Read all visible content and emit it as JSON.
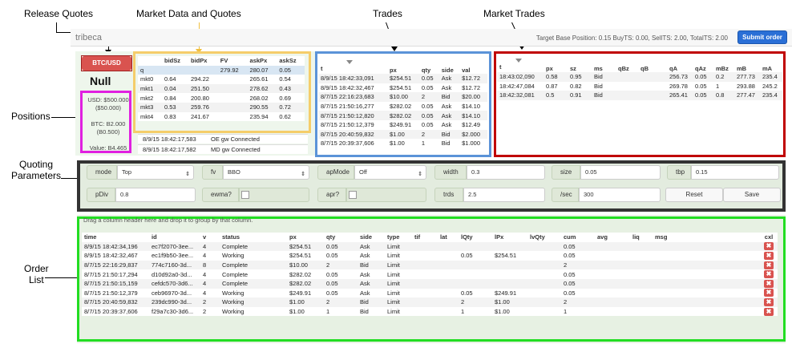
{
  "annotations": {
    "release_quotes": "Release Quotes",
    "market_data": "Market Data and Quotes",
    "trades": "Trades",
    "market_trades": "Market Trades",
    "positions": "Positions",
    "quoting_parameters_1": "Quoting",
    "quoting_parameters_2": "Parameters",
    "order_list_1": "Order",
    "order_list_2": "List"
  },
  "topbar": {
    "brand": "tribeca",
    "stats": "Target Base Position: 0.15     BuyTS: 0.00, SellTS: 2.00, TotalTS: 2.00",
    "submit_label": "Submit order"
  },
  "positions": {
    "symbol_button": "BTC/USD",
    "status": "Null",
    "usd": "USD: $500.000",
    "usd_held": "($50.000)",
    "btc": "BTC: B2.000",
    "btc_held": "(B0.500)",
    "value": "Value: B4.465"
  },
  "market_data": {
    "headers": [
      "",
      "bidSz",
      "bidPx",
      "FV",
      "askPx",
      "askSz"
    ],
    "rows": [
      [
        "q",
        "",
        "",
        "279.92",
        "280.07",
        "0.05"
      ],
      [
        "mkt0",
        "0.64",
        "294.22",
        "",
        "265.61",
        "0.54"
      ],
      [
        "mkt1",
        "0.04",
        "251.50",
        "",
        "278.62",
        "0.43"
      ],
      [
        "mkt2",
        "0.84",
        "200.80",
        "",
        "268.02",
        "0.69"
      ],
      [
        "mkt3",
        "0.53",
        "259.76",
        "",
        "290.55",
        "0.72"
      ],
      [
        "mkt4",
        "0.83",
        "241.67",
        "",
        "235.94",
        "0.62"
      ]
    ],
    "connections": [
      {
        "time": "8/9/15 18:42:17,583",
        "text": "OE gw Connected"
      },
      {
        "time": "8/9/15 18:42:17,582",
        "text": "MD gw Connected"
      }
    ]
  },
  "trades": {
    "headers": [
      "t",
      "px",
      "qty",
      "side",
      "val"
    ],
    "rows": [
      [
        "8/9/15 18:42:33,091",
        "$254.51",
        "0.05",
        "Ask",
        "$12.72"
      ],
      [
        "8/9/15 18:42:32,467",
        "$254.51",
        "0.05",
        "Ask",
        "$12.72"
      ],
      [
        "8/7/15 22:16:23,683",
        "$10.00",
        "2",
        "Bid",
        "$20.00"
      ],
      [
        "8/7/15 21:50:16,277",
        "$282.02",
        "0.05",
        "Ask",
        "$14.10"
      ],
      [
        "8/7/15 21:50:12,820",
        "$282.02",
        "0.05",
        "Ask",
        "$14.10"
      ],
      [
        "8/7/15 21:50:12,379",
        "$249.91",
        "0.05",
        "Ask",
        "$12.49"
      ],
      [
        "8/7/15 20:40:59,832",
        "$1.00",
        "2",
        "Bid",
        "$2.000"
      ],
      [
        "8/7/15 20:39:37,606",
        "$1.00",
        "1",
        "Bid",
        "$1.000"
      ]
    ]
  },
  "market_trades": {
    "headers": [
      "t",
      "px",
      "sz",
      "ms",
      "qBz",
      "qB",
      "qA",
      "qAz",
      "mBz",
      "mB",
      "mA"
    ],
    "rows": [
      [
        "18:43:02,090",
        "0.58",
        "0.95",
        "Bid",
        "",
        "",
        "256.73",
        "0.05",
        "0.2",
        "277.73",
        "235.4"
      ],
      [
        "18:42:47,084",
        "0.87",
        "0.82",
        "Bid",
        "",
        "",
        "269.78",
        "0.05",
        "1",
        "293.88",
        "245.2"
      ],
      [
        "18:42:32,081",
        "0.5",
        "0.91",
        "Bid",
        "",
        "",
        "265.41",
        "0.05",
        "0.8",
        "277.47",
        "235.4"
      ]
    ]
  },
  "quoting": {
    "mode_label": "mode",
    "mode_value": "Top",
    "fv_label": "fv",
    "fv_value": "BBO",
    "apmode_label": "apMode",
    "apmode_value": "Off",
    "width_label": "width",
    "width_value": "0.3",
    "size_label": "size",
    "size_value": "0.05",
    "tbp_label": "tbp",
    "tbp_value": "0.15",
    "pdiv_label": "pDiv",
    "pdiv_value": "0.8",
    "ewma_label": "ewma?",
    "apr_label": "apr?",
    "trds_label": "trds",
    "trds_value": "2.5",
    "sec_label": "/sec",
    "sec_value": "300",
    "reset_label": "Reset",
    "save_label": "Save"
  },
  "orders": {
    "hint": "Drag a column header here and drop it to group by that column.",
    "headers": [
      "time",
      "id",
      "v",
      "status",
      "px",
      "qty",
      "side",
      "type",
      "tif",
      "lat",
      "lQty",
      "lPx",
      "lvQty",
      "cum",
      "avg",
      "liq",
      "msg",
      "cxl"
    ],
    "rows": [
      [
        "8/9/15 18:42:34,196",
        "ec7f2070-3ee...",
        "4",
        "Complete",
        "$254.51",
        "0.05",
        "Ask",
        "Limit",
        "",
        "",
        "",
        "",
        "",
        "0.05",
        "",
        "",
        ""
      ],
      [
        "8/9/15 18:42:32,467",
        "ec1f9b50-3ee...",
        "4",
        "Working",
        "$254.51",
        "0.05",
        "Ask",
        "Limit",
        "",
        "",
        "0.05",
        "$254.51",
        "",
        "0.05",
        "",
        "",
        ""
      ],
      [
        "8/7/15 22:16:29,837",
        "774c7160-3d...",
        "8",
        "Complete",
        "$10.00",
        "2",
        "Bid",
        "Limit",
        "",
        "",
        "",
        "",
        "",
        "2",
        "",
        "",
        ""
      ],
      [
        "8/7/15 21:50:17,294",
        "d10d92a0-3d...",
        "4",
        "Complete",
        "$282.02",
        "0.05",
        "Ask",
        "Limit",
        "",
        "",
        "",
        "",
        "",
        "0.05",
        "",
        "",
        ""
      ],
      [
        "8/7/15 21:50:15,159",
        "cefdc570-3d6...",
        "4",
        "Complete",
        "$282.02",
        "0.05",
        "Ask",
        "Limit",
        "",
        "",
        "",
        "",
        "",
        "0.05",
        "",
        "",
        ""
      ],
      [
        "8/7/15 21:50:12,379",
        "ceb96970-3d...",
        "4",
        "Working",
        "$249.91",
        "0.05",
        "Ask",
        "Limit",
        "",
        "",
        "0.05",
        "$249.91",
        "",
        "0.05",
        "",
        "",
        ""
      ],
      [
        "8/7/15 20:40:59,832",
        "239dc990-3d...",
        "2",
        "Working",
        "$1.00",
        "2",
        "Bid",
        "Limit",
        "",
        "",
        "2",
        "$1.00",
        "",
        "2",
        "",
        "",
        ""
      ],
      [
        "8/7/15 20:39:37,606",
        "f29a7c30-3d6...",
        "2",
        "Working",
        "$1.00",
        "1",
        "Bid",
        "Limit",
        "",
        "",
        "1",
        "$1.00",
        "",
        "1",
        "",
        "",
        ""
      ]
    ],
    "cxl_glyph": "✖"
  },
  "colors": {
    "release": "#d9534f",
    "positions": "#e020e0",
    "market_data": "#f5cd6a",
    "trades": "#5b93d8",
    "market_trades": "#c00000",
    "quoting": "#333333",
    "orders": "#22dd22"
  }
}
